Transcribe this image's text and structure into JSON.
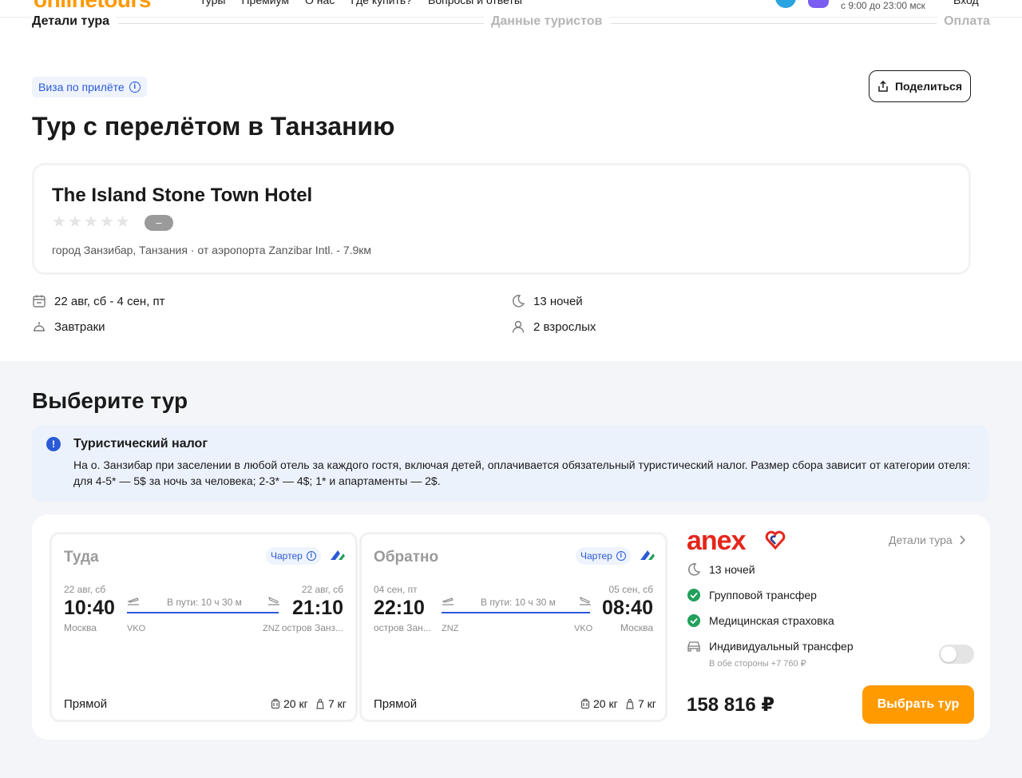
{
  "header": {
    "logo": "onlinetours",
    "nav": [
      "Туры",
      "Премиум",
      "О нас",
      "Где купить?",
      "Вопросы и ответы"
    ],
    "hours": "с 9:00 до 23:00 мск",
    "login": "Вход"
  },
  "steps": [
    "Детали тура",
    "Данные туристов",
    "Оплата"
  ],
  "visa_badge": "Виза по прилёте",
  "share_label": "Поделиться",
  "title": "Тур с перелётом в Танзанию",
  "hotel": {
    "name": "The Island Stone Town Hotel",
    "stars": 0,
    "rating": "–",
    "location": "город Занзибар, Танзания · от аэропорта Zanzibar Intl. - 7.9км"
  },
  "features": {
    "dates": "22 авг, сб - 4 сен, пт",
    "nights": "13 ночей",
    "meals": "Завтраки",
    "guests": "2 взрослых"
  },
  "choose_title": "Выберите тур",
  "notice": {
    "title": "Туристический налог",
    "text": "На о. Занзибар при заселении в любой отель за каждого гостя, включая детей, оплачивается обязательный туристический налог. Размер сбора зависит от категории отеля: для 4-5* — 5$ за ночь за человека; 2-3* — 4$; 1* и апартаменты — 2$."
  },
  "flights": [
    {
      "direction": "Туда",
      "charter": "Чартер",
      "dep_date": "22 авг, сб",
      "dep_time": "10:40",
      "dep_city": "Москва",
      "dep_code": "VKO",
      "duration": "В пути: 10 ч 30 м",
      "arr_date": "22 авг, сб",
      "arr_time": "21:10",
      "arr_city": "остров Занз...",
      "arr_code": "ZNZ",
      "type": "Прямой",
      "baggage": "20 кг",
      "hand": "7 кг"
    },
    {
      "direction": "Обратно",
      "charter": "Чартер",
      "dep_date": "04 сен, пт",
      "dep_time": "22:10",
      "dep_city": "остров Зан...",
      "dep_code": "ZNZ",
      "duration": "В пути: 10 ч 30 м",
      "arr_date": "05 сен, сб",
      "arr_time": "08:40",
      "arr_city": "Москва",
      "arr_code": "VKO",
      "type": "Прямой",
      "baggage": "20 кг",
      "hand": "7 кг"
    }
  ],
  "offer": {
    "operator": "anex",
    "details": "Детали тура",
    "nights": "13 ночей",
    "group_transfer": "Групповой трансфер",
    "insurance": "Медицинская страховка",
    "individual_transfer": "Индивидуальный трансфер",
    "individual_sub": "В обе стороны +7 760 ₽",
    "individual_on": false,
    "price": "158 816 ₽",
    "choose_button": "Выбрать тур"
  },
  "colors": {
    "accent": "#ff9a00",
    "link": "#2b5ad6",
    "check": "#22a05a",
    "anex": "#e5261b"
  }
}
